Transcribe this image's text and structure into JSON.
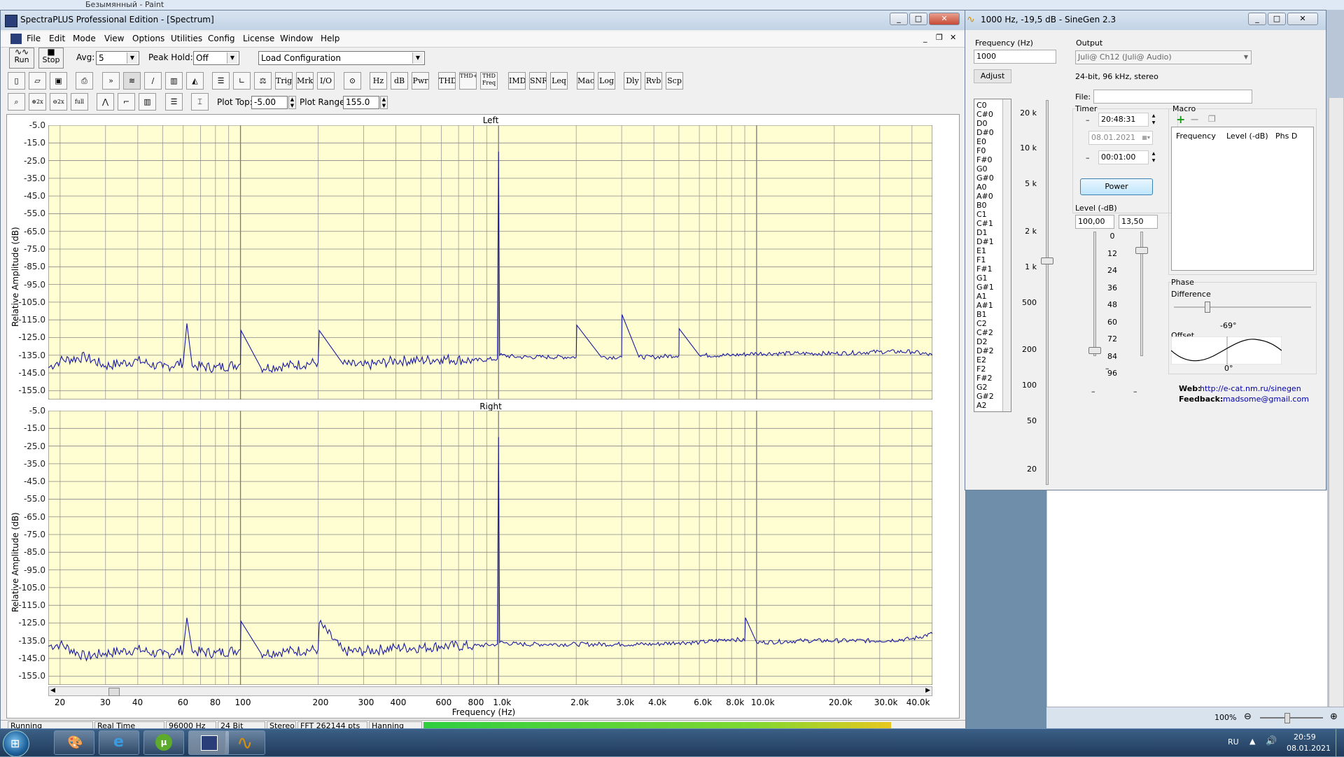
{
  "paint": {
    "title": "Безымянный - Paint",
    "zoom": "100%"
  },
  "spectraplus": {
    "title": "SpectraPLUS Professional Edition - [Spectrum]",
    "menu": [
      "File",
      "Edit",
      "Mode",
      "View",
      "Options",
      "Utilities",
      "Config",
      "License",
      "Window",
      "Help"
    ],
    "run_label": "Run",
    "stop_label": "Stop",
    "avg_label": "Avg:",
    "avg_value": "5",
    "peak_hold_label": "Peak Hold:",
    "peak_hold_value": "Off",
    "config_value": "Load Configuration",
    "toolbar2_text_buttons": [
      "Trig",
      "Mrk",
      "I/O",
      "Hz",
      "dB",
      "Pwr",
      "THD",
      "THD+N",
      "THD Freq",
      "IMD",
      "SNR",
      "Leq",
      "Mac",
      "Log",
      "Dly",
      "Rvb",
      "Scp"
    ],
    "plot_top_label": "Plot Top:",
    "plot_top_value": "-5.00",
    "plot_range_label": "Plot Range:",
    "plot_range_value": "155.0",
    "status": [
      "Running",
      "Real Time",
      "96000 Hz",
      "24 Bit",
      "Stereo",
      "FFT 262144 pts",
      "Hanning"
    ]
  },
  "chart_data": [
    {
      "type": "line",
      "title": "Left",
      "ylabel": "Relative Amplitude (dB)",
      "xlabel": "Frequency (Hz)",
      "x_scale": "log",
      "xlim": [
        18,
        48000
      ],
      "ylim": [
        -160,
        -5
      ],
      "y_ticks": [
        "-5.0",
        "-15.0",
        "-25.0",
        "-35.0",
        "-45.0",
        "-55.0",
        "-65.0",
        "-75.0",
        "-85.0",
        "-95.0",
        "-105.0",
        "-115.0",
        "-125.0",
        "-135.0",
        "-145.0",
        "-155.0"
      ],
      "grid": true,
      "series": [
        {
          "color": "#1a1aa0",
          "x": [
            18,
            20,
            25,
            30,
            40,
            50,
            60,
            62,
            65,
            80,
            100,
            100.5,
            120,
            150,
            200,
            202,
            250,
            300,
            400,
            500,
            600,
            800,
            990,
            1000,
            1010,
            1200,
            1500,
            2000,
            2010,
            2500,
            3000,
            3010,
            3500,
            4000,
            5000,
            5010,
            6000,
            8000,
            10000,
            15000,
            20000,
            30000,
            40000,
            48000
          ],
          "y": [
            -142,
            -138,
            -136,
            -141,
            -138,
            -142,
            -139,
            -117,
            -141,
            -142,
            -140,
            -121,
            -142,
            -141,
            -139,
            -121,
            -140,
            -141,
            -138,
            -138,
            -137,
            -138,
            -137,
            -20,
            -135,
            -136,
            -136,
            -136,
            -118,
            -136,
            -136,
            -112,
            -136,
            -136,
            -135,
            -120,
            -135,
            -135,
            -134,
            -134,
            -134,
            -133,
            -133,
            -135
          ]
        }
      ]
    },
    {
      "type": "line",
      "title": "Right",
      "ylabel": "Relative Amplitude (dB)",
      "xlabel": "Frequency (Hz)",
      "x_scale": "log",
      "xlim": [
        18,
        48000
      ],
      "ylim": [
        -160,
        -5
      ],
      "y_ticks": [
        "-5.0",
        "-15.0",
        "-25.0",
        "-35.0",
        "-45.0",
        "-55.0",
        "-65.0",
        "-75.0",
        "-85.0",
        "-95.0",
        "-105.0",
        "-115.0",
        "-125.0",
        "-135.0",
        "-145.0",
        "-155.0"
      ],
      "x_ticks": [
        "20",
        "30",
        "40",
        "60",
        "80",
        "100",
        "200",
        "300",
        "400",
        "600",
        "800",
        "1.0k",
        "2.0k",
        "3.0k",
        "4.0k",
        "6.0k",
        "8.0k",
        "10.0k",
        "20.0k",
        "30.0k",
        "40.0k"
      ],
      "grid": true,
      "series": [
        {
          "color": "#1a1aa0",
          "x": [
            18,
            20,
            25,
            30,
            40,
            50,
            60,
            62,
            65,
            80,
            100,
            100.5,
            120,
            150,
            200,
            202,
            250,
            300,
            400,
            500,
            600,
            800,
            990,
            1000,
            1010,
            1200,
            1500,
            2000,
            3000,
            4000,
            5000,
            6000,
            8000,
            9000,
            9050,
            10000,
            15000,
            20000,
            30000,
            40000,
            48000
          ],
          "y": [
            -138,
            -137,
            -144,
            -142,
            -140,
            -143,
            -140,
            -122,
            -141,
            -142,
            -140,
            -124,
            -142,
            -141,
            -140,
            -125,
            -141,
            -141,
            -139,
            -139,
            -138,
            -138,
            -137,
            -20,
            -136,
            -137,
            -137,
            -137,
            -137,
            -137,
            -136,
            -136,
            -134,
            -135,
            -122,
            -136,
            -135,
            -135,
            -135,
            -134,
            -131
          ]
        }
      ]
    }
  ],
  "sinegen": {
    "title": "1000 Hz, -19,5 dB - SineGen 2.3",
    "frequency_label": "Frequency (Hz)",
    "frequency_value": "1000",
    "adjust_label": "Adjust",
    "notes": [
      "C0",
      "C#0",
      "D0",
      "D#0",
      "E0",
      "F0",
      "F#0",
      "G0",
      "G#0",
      "A0",
      "A#0",
      "B0",
      "C1",
      "C#1",
      "D1",
      "D#1",
      "E1",
      "F1",
      "F#1",
      "G1",
      "G#1",
      "A1",
      "A#1",
      "B1",
      "C2",
      "C#2",
      "D2",
      "D#2",
      "E2",
      "F2",
      "F#2",
      "G2",
      "G#2",
      "A2"
    ],
    "freq_scale": [
      "20 k",
      "10 k",
      "5 k",
      "2 k",
      "1 k",
      "500",
      "200",
      "100",
      "50",
      "20"
    ],
    "output_label": "Output",
    "output_device": "Juli@ Ch12 (Juli@ Audio)",
    "output_format": "24-bit, 96 kHz, stereo",
    "file_label": "File:",
    "timer_label": "Timer",
    "timer_time": "20:48:31",
    "timer_date": "08.01.2021",
    "timer_duration": "00:01:00",
    "power_label": "Power",
    "level_label": "Level (-dB)",
    "level_value1": "100,00",
    "level_value2": "13,50",
    "level_scale": [
      "0",
      "12",
      "24",
      "36",
      "48",
      "60",
      "72",
      "84",
      "96"
    ],
    "macro_label": "Macro",
    "macro_columns": [
      "Frequency",
      "Level (-dB)",
      "Phs D"
    ],
    "phase_label": "Phase",
    "difference_label": "Difference",
    "difference_value": "-69°",
    "offset_label": "Offset",
    "offset_value": "0°",
    "web_label": "Web:",
    "web_value": "http://e-cat.nm.ru/sinegen",
    "feedback_label": "Feedback:",
    "feedback_value": "madsome@gmail.com"
  },
  "taskbar": {
    "lang": "RU",
    "time": "20:59",
    "date": "08.01.2021"
  }
}
